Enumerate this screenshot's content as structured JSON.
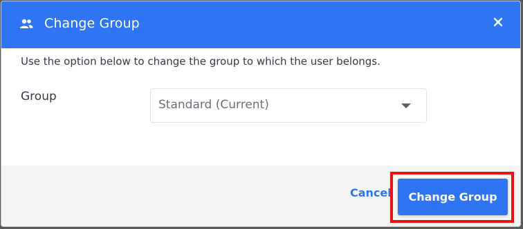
{
  "dialog": {
    "title": "Change Group",
    "header_icon": "users-icon",
    "close_icon": "close-icon",
    "description": "Use the option below to change the group to which the user belongs.",
    "group_field": {
      "label": "Group",
      "selected_value": "Standard (Current)"
    },
    "footer": {
      "cancel_label": "Cancel",
      "submit_label": "Change Group"
    }
  },
  "colors": {
    "accent": "#2f74f2",
    "highlight": "#ee1111"
  }
}
